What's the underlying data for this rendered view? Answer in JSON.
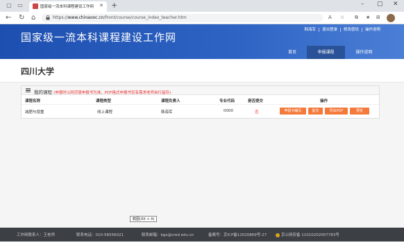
{
  "browser": {
    "tab_title": "国家级一流本科课程建设工作网",
    "url_prefix": "https://",
    "url_domain": "www.chinaooc.cn",
    "url_path": "/front/course/course_index_teacher.htm"
  },
  "header": {
    "site_title": "国家级一流本科课程建设工作网",
    "top_links": [
      "韩海军",
      "退出登录",
      "修改密码",
      "操作说明"
    ],
    "nav": [
      "首页",
      "申报课程",
      "操作说明"
    ]
  },
  "university": "四川大学",
  "panel": {
    "title": "我的课程",
    "note": "(申报时以网页版申报书为准，PDF格式申报书仅有需求老师自行留存)",
    "columns": [
      "课程名称",
      "课程类型",
      "课程负责人",
      "专业代码",
      "是否提交",
      "操作"
    ],
    "rows": [
      {
        "name": "减肥与增重",
        "type": "线上课程",
        "leader": "韩海军",
        "code": "0000",
        "submitted": "否",
        "actions": [
          "申报书编写",
          "提交",
          "导出PDF",
          "预览"
        ]
      }
    ]
  },
  "tooltip": "截图(Alt + A)",
  "footer": {
    "contact": "工作网联系人：王老师",
    "phone": "联系电话：010-58556021",
    "email": "联系邮箱：bgs@cred.edu.cn",
    "icp": "备案号：京ICP备12020869号-27",
    "police": "京公网安备 11010202007783号"
  },
  "colors": {
    "header_blue": "#1d4fb0",
    "action_orange": "#f4793b",
    "warn_red": "#e33333",
    "footer_dark": "#3c3f44"
  }
}
